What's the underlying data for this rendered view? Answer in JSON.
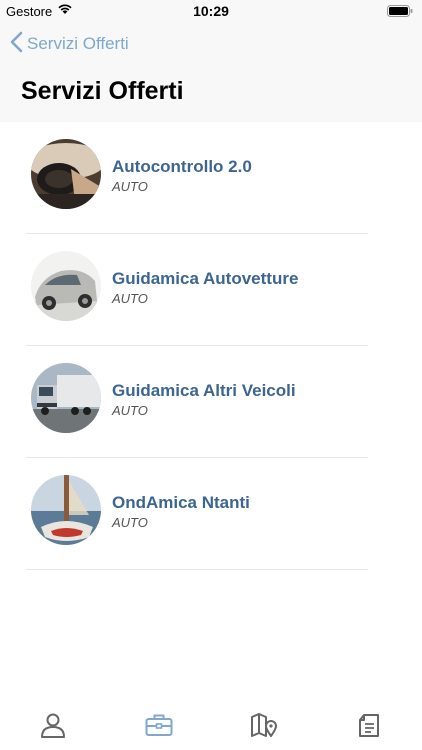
{
  "status_bar": {
    "carrier": "Gestore",
    "time": "10:29"
  },
  "nav": {
    "back_label": "Servizi Offerti",
    "title": "Servizi Offerti"
  },
  "services": [
    {
      "title": "Autocontrollo 2.0",
      "category": "AUTO",
      "image": "car-interior"
    },
    {
      "title": "Guidamica Autovetture",
      "category": "AUTO",
      "image": "silver-car"
    },
    {
      "title": "Guidamica Altri Veicoli",
      "category": "AUTO",
      "image": "truck"
    },
    {
      "title": "OndAmica Ntanti",
      "category": "AUTO",
      "image": "sailboat"
    }
  ],
  "tab_bar": [
    {
      "icon": "person-icon",
      "active": false
    },
    {
      "icon": "briefcase-icon",
      "active": true
    },
    {
      "icon": "map-icon",
      "active": false
    },
    {
      "icon": "document-icon",
      "active": false
    }
  ],
  "colors": {
    "accent": "#7fa8cc",
    "title_blue": "#3d6591",
    "tab_inactive": "#666666"
  }
}
